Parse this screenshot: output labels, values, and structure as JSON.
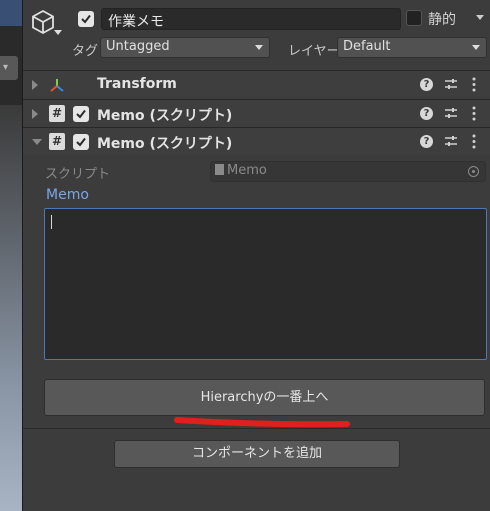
{
  "header": {
    "object_name": "作業メモ",
    "static_label": "静的",
    "tag_label": "タグ",
    "tag_value": "Untagged",
    "layer_label": "レイヤー",
    "layer_value": "Default"
  },
  "components": [
    {
      "title": "Transform",
      "icon": "transform-axis-icon",
      "expanded": false
    },
    {
      "title": "Memo (スクリプト)",
      "icon": "csharp-script-icon",
      "expanded": false
    },
    {
      "title": "Memo (スクリプト)",
      "icon": "csharp-script-icon",
      "expanded": true
    }
  ],
  "memo_component": {
    "script_label": "スクリプト",
    "script_value": "Memo",
    "memo_label": "Memo",
    "memo_text": "",
    "button_label": "Hierarchyの一番上へ"
  },
  "footer": {
    "add_component_label": "コンポーネントを追加"
  },
  "colors": {
    "panel_bg": "#3c3c3c",
    "field_bg": "#2a2a2a",
    "accent_blue": "#7aa6e8",
    "focus_border": "#4c78b8",
    "annotation_red": "#e0201c"
  }
}
